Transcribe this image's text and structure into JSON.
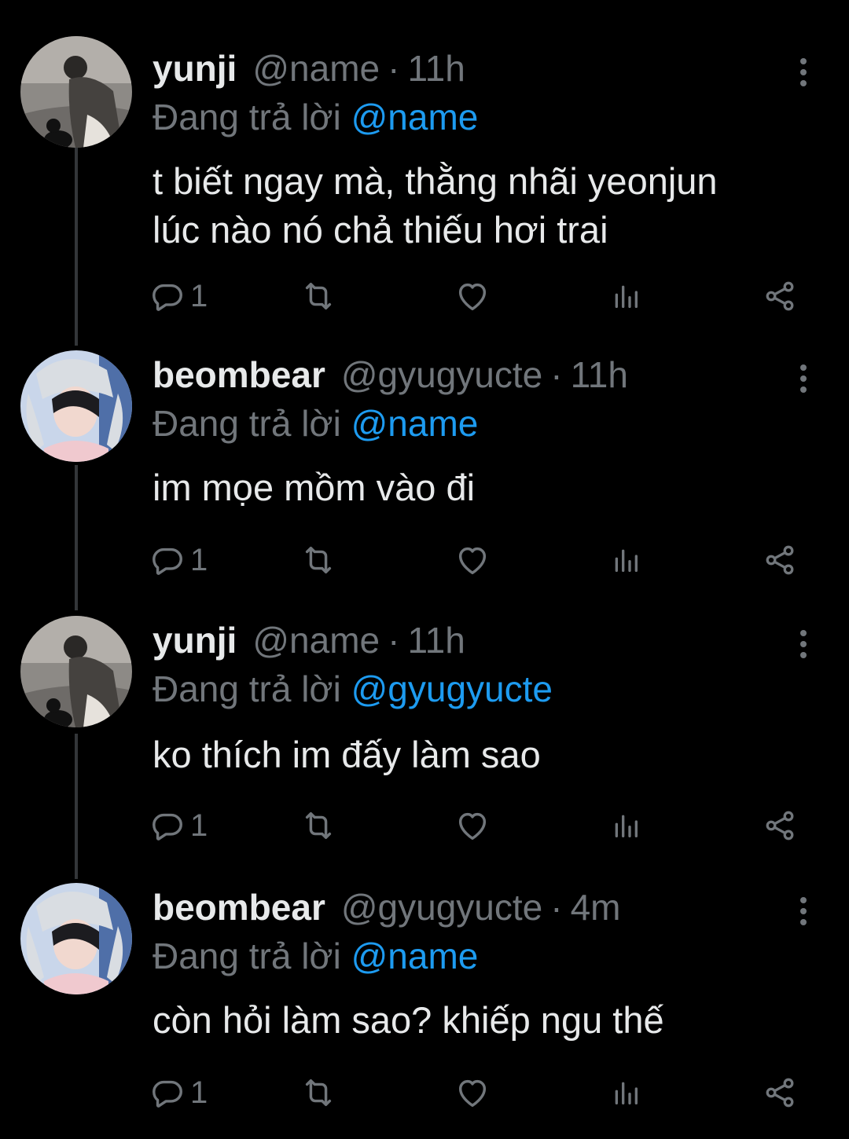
{
  "colors": {
    "background": "#000000",
    "text_primary": "#e7e9ea",
    "text_secondary": "#71767b",
    "mention": "#1d9bf0",
    "thread_line": "#333639"
  },
  "tweets": [
    {
      "display_name": "yunji",
      "handle": "@name",
      "separator": "·",
      "time": "11h",
      "replying_prefix": "Đang trả lời",
      "replying_to": "@name",
      "text_lines": [
        "t biết ngay mà, thằng nhãi yeonjun",
        "lúc nào nó chả thiếu hơi trai"
      ],
      "reply_count": "1",
      "avatar_icon": "avatar-yunji"
    },
    {
      "display_name": "beombear",
      "handle": "@gyugyucte",
      "separator": "·",
      "time": "11h",
      "replying_prefix": "Đang trả lời",
      "replying_to": "@name",
      "text_lines": [
        "im mọe mồm vào đi"
      ],
      "reply_count": "1",
      "avatar_icon": "avatar-beombear"
    },
    {
      "display_name": "yunji",
      "handle": "@name",
      "separator": "·",
      "time": "11h",
      "replying_prefix": "Đang trả lời",
      "replying_to": "@gyugyucte",
      "text_lines": [
        "ko thích im đấy làm sao"
      ],
      "reply_count": "1",
      "avatar_icon": "avatar-yunji"
    },
    {
      "display_name": "beombear",
      "handle": "@gyugyucte",
      "separator": "·",
      "time": "4m",
      "replying_prefix": "Đang trả lời",
      "replying_to": "@name",
      "text_lines": [
        "còn hỏi làm sao? khiếp ngu thế"
      ],
      "reply_count": "1",
      "avatar_icon": "avatar-beombear"
    }
  ],
  "icons": {
    "reply": "reply-icon",
    "retweet": "retweet-icon",
    "like": "heart-icon",
    "views": "views-icon",
    "share": "share-icon",
    "more": "more-vertical-icon"
  }
}
